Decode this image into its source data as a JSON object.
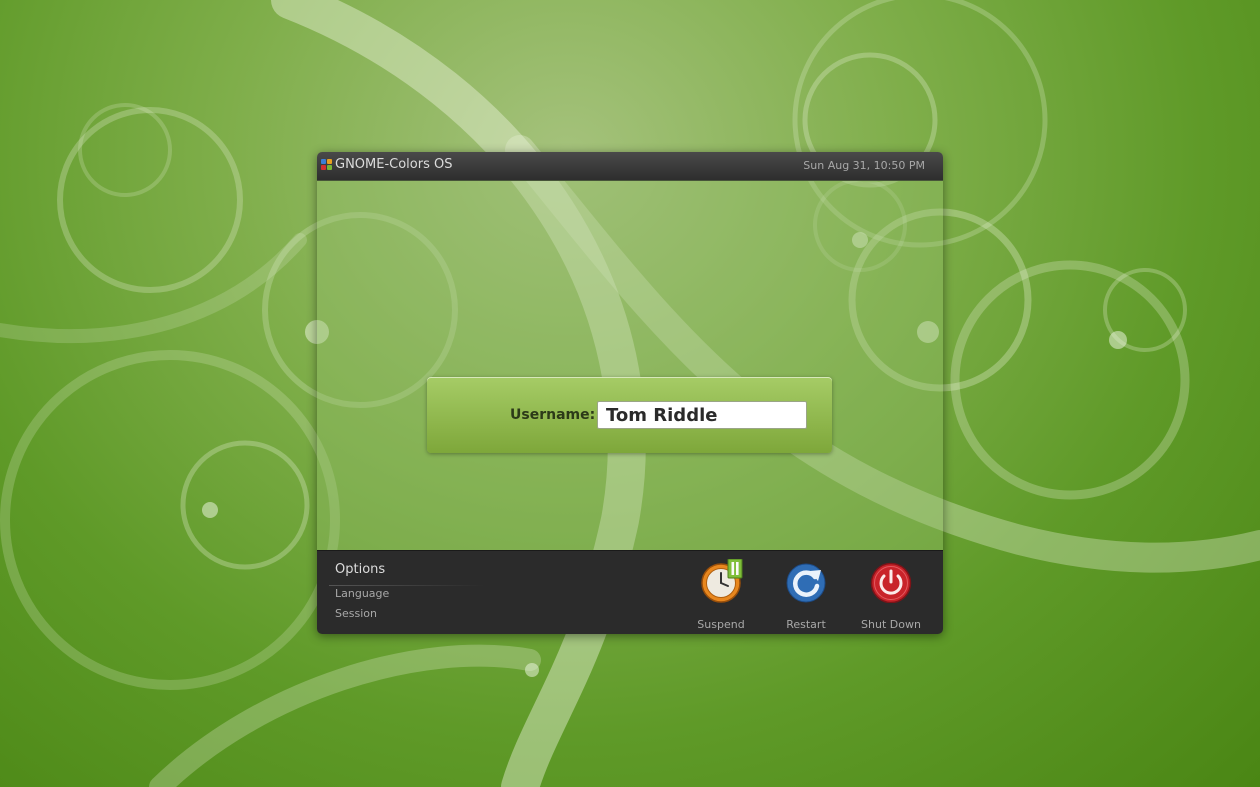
{
  "header": {
    "os_name": "GNOME-Colors OS",
    "clock": "Sun Aug 31, 10:50 PM"
  },
  "login": {
    "username_label": "Username:",
    "username_value": "Tom Riddle"
  },
  "options": {
    "title": "Options",
    "items": [
      {
        "label": "Language"
      },
      {
        "label": "Session"
      }
    ]
  },
  "actions": [
    {
      "label": "Suspend",
      "icon": "suspend-clock-icon"
    },
    {
      "label": "Restart",
      "icon": "restart-icon"
    },
    {
      "label": "Shut Down",
      "icon": "power-icon"
    }
  ],
  "colors": {
    "background_green": "#5f9a28",
    "login_box_green": "#8fb84c",
    "panel_dark": "#2b2b2b",
    "shutdown_red": "#c9232a",
    "restart_blue": "#2f6db5",
    "suspend_orange": "#e8871e"
  }
}
